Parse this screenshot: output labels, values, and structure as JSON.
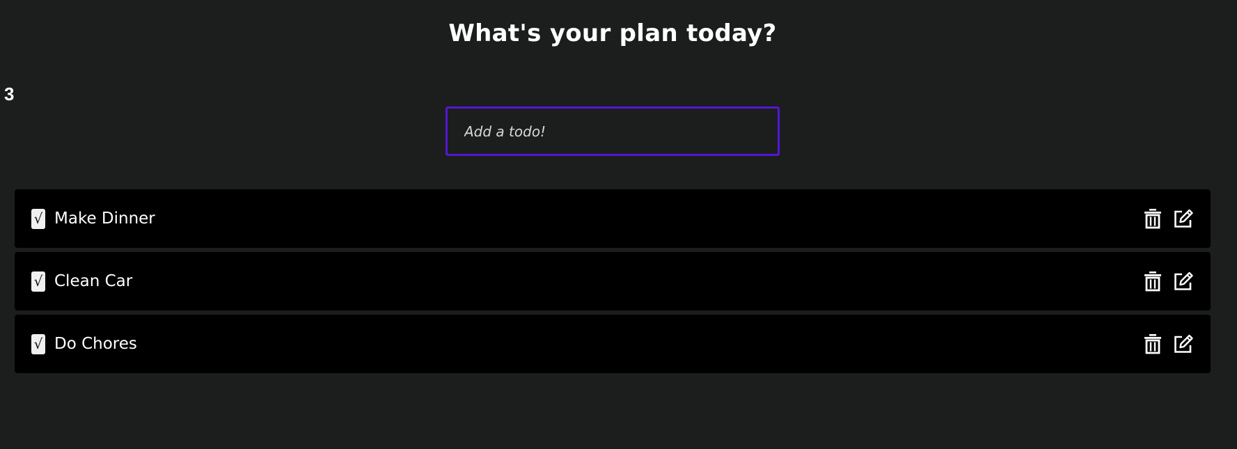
{
  "header": {
    "title": "What's your plan today?"
  },
  "todo_count": "3",
  "new_todo": {
    "value": "",
    "placeholder": "Add a todo!"
  },
  "todos": [
    {
      "label": "Make Dinner",
      "check_glyph": "√"
    },
    {
      "label": "Clean Car",
      "check_glyph": "√"
    },
    {
      "label": "Do Chores",
      "check_glyph": "√"
    }
  ],
  "icons": {
    "delete": "trash-icon",
    "edit": "edit-icon"
  },
  "colors": {
    "background": "#1c1d1d",
    "row_background": "#000000",
    "input_border": "#5218d4",
    "text": "#ffffff"
  }
}
